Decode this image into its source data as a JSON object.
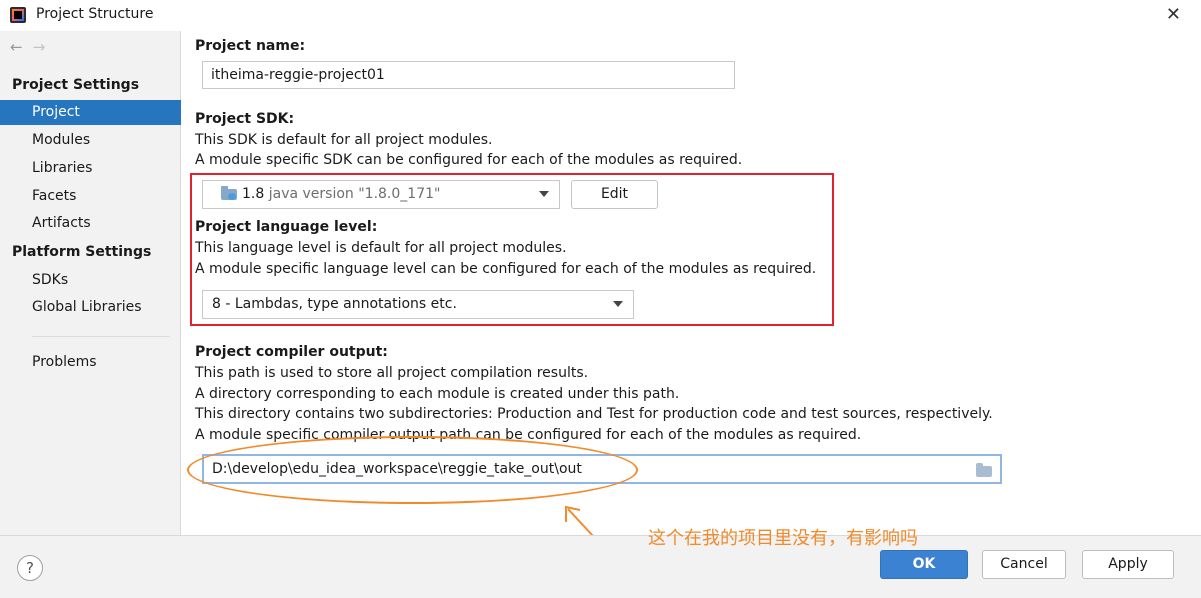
{
  "window": {
    "title": "Project Structure",
    "close_glyph": "✕"
  },
  "nav": {
    "back_glyph": "←",
    "forward_glyph": "→"
  },
  "sidebar": {
    "project_settings_heading": "Project Settings",
    "project_items": [
      "Project",
      "Modules",
      "Libraries",
      "Facets",
      "Artifacts"
    ],
    "platform_settings_heading": "Platform Settings",
    "platform_items": [
      "SDKs",
      "Global Libraries"
    ],
    "problems_label": "Problems",
    "selected": "Project"
  },
  "main": {
    "project_name_label": "Project name:",
    "project_name_value": "itheima-reggie-project01",
    "sdk_label": "Project SDK:",
    "sdk_desc_1": "This SDK is default for all project modules.",
    "sdk_desc_2": "A module specific SDK can be configured for each of the modules as required.",
    "sdk_version": "1.8",
    "sdk_detail": "java version \"1.8.0_171\"",
    "edit_button": "Edit",
    "lang_label": "Project language level:",
    "lang_desc_1": "This language level is default for all project modules.",
    "lang_desc_2": "A module specific language level can be configured for each of the modules as required.",
    "lang_value": "8 - Lambdas, type annotations etc.",
    "output_label": "Project compiler output:",
    "output_desc_1": "This path is used to store all project compilation results.",
    "output_desc_2": "A directory corresponding to each module is created under this path.",
    "output_desc_3": "This directory contains two subdirectories: Production and Test for production code and test sources, respectively.",
    "output_desc_4": "A module specific compiler output path can be configured for each of the modules as required.",
    "output_path": "D:\\develop\\edu_idea_workspace\\reggie_take_out\\out"
  },
  "annotation": {
    "text": "这个在我的项目里没有，有影响吗",
    "color": "#f18a2a",
    "highlight_color": "#e0232e"
  },
  "footer": {
    "help_glyph": "?",
    "ok_label": "OK",
    "cancel_label": "Cancel",
    "apply_label": "Apply"
  }
}
